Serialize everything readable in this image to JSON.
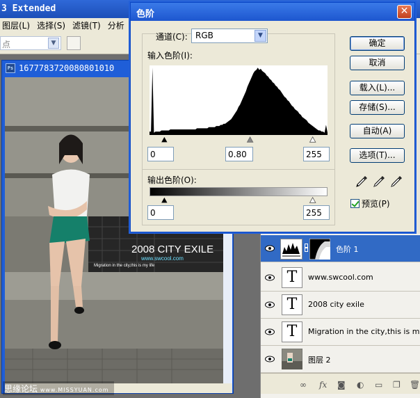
{
  "app": {
    "title": "3 Extended",
    "menu": [
      "图层(L)",
      "选择(S)",
      "滤镜(T)",
      "分析"
    ],
    "options_select": "点"
  },
  "document": {
    "title": "1677783720080801010",
    "photo_title": "2008 CITY EXILE",
    "photo_site": "www.swcool.com",
    "photo_caption": "Migration in the city,this is my life"
  },
  "watermark": {
    "text": "思缘论坛",
    "url": "www.MISSYUAN.com"
  },
  "levels_dialog": {
    "title": "色阶",
    "channel_label": "通道(C):",
    "channel_value": "RGB",
    "input_label": "输入色阶(I):",
    "input_black": "0",
    "input_gamma": "0.80",
    "input_white": "255",
    "input_gamma_position": 0.578,
    "output_label": "输出色阶(O):",
    "output_black": "0",
    "output_white": "255",
    "buttons": {
      "ok": "确定",
      "cancel": "取消",
      "load": "载入(L)...",
      "save": "存储(S)...",
      "auto": "自动(A)",
      "options": "选项(T)..."
    },
    "preview_label": "预览(P)",
    "preview_checked": true,
    "histogram": [
      3,
      3,
      60,
      2,
      3,
      3,
      3,
      3,
      4,
      4,
      4,
      4,
      4,
      4,
      5,
      5,
      5,
      5,
      5,
      5,
      5,
      5,
      5,
      5,
      5,
      5,
      5,
      5,
      5,
      5,
      5,
      5,
      6,
      6,
      6,
      6,
      6,
      6,
      6,
      6,
      7,
      7,
      7,
      7,
      7,
      8,
      8,
      8,
      9,
      9,
      10,
      10,
      11,
      12,
      13,
      14,
      16,
      18,
      20,
      22,
      25,
      27,
      30,
      33,
      36,
      39,
      43,
      46,
      49,
      52,
      55,
      57,
      58,
      60,
      58,
      59,
      57,
      56,
      55,
      53,
      52,
      50,
      49,
      47,
      46,
      44,
      43,
      41,
      40,
      38,
      36,
      34,
      33,
      31,
      30,
      28,
      26,
      25,
      23,
      22,
      21,
      19,
      18,
      16,
      15,
      14,
      13,
      11,
      10,
      9,
      8,
      7,
      6,
      5,
      4,
      4,
      3,
      3,
      2,
      9,
      2
    ]
  },
  "layers": [
    {
      "name": "色阶 1",
      "type": "adjustment",
      "selected": true
    },
    {
      "name": "www.swcool.com",
      "type": "text",
      "thumb": "T",
      "selected": false
    },
    {
      "name": "2008 city exile",
      "type": "text",
      "thumb": "T",
      "selected": false
    },
    {
      "name": "Migration in the city,this is my ...",
      "type": "text",
      "thumb": "T",
      "selected": false
    },
    {
      "name": "图层 2",
      "type": "image",
      "selected": false
    }
  ],
  "layers_footer_icons": [
    "link-icon",
    "fx-icon",
    "mask-icon",
    "adjustment-icon",
    "folder-icon",
    "new-layer-icon",
    "trash-icon"
  ],
  "colors": {
    "titlebar": "#1d56cf",
    "selected_layer": "#316ac5",
    "dialog_bg": "#ece9d8",
    "close_button": "#c0401d"
  }
}
